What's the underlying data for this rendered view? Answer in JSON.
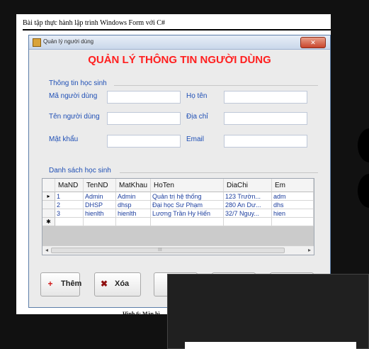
{
  "document": {
    "header": "Bài tập thực hành lập trình Windows Form với C#",
    "caption": "Hình 6: Màn hì"
  },
  "window": {
    "title": "Quản lý người dùng",
    "close_glyph": "✕"
  },
  "form": {
    "main_title": "QUẢN LÝ THÔNG TIN NGƯỜI DÙNG",
    "group_info_label": "Thông tin học sinh",
    "labels": {
      "ma_nguoi_dung": "Mã người dùng",
      "ten_nguoi_dung": "Tên người dùng",
      "mat_khau": "Mật khẩu",
      "ho_ten": "Họ tên",
      "dia_chi": "Địa chỉ",
      "email": "Email"
    },
    "list_label": "Danh sách học sinh"
  },
  "grid": {
    "columns": [
      "MaND",
      "TenND",
      "MatKhau",
      "HoTen",
      "DiaChi",
      "Em"
    ],
    "row_markers": [
      "▸",
      "",
      "",
      "✱"
    ],
    "rows": [
      [
        "1",
        "Admin",
        "Admin",
        "Quản trị hệ thống",
        "123 Trườn...",
        "adm"
      ],
      [
        "2",
        "DHSP",
        "dhsp",
        "Đại học Sư Phạm",
        "280 An Dư...",
        "dhs"
      ],
      [
        "3",
        "hienlth",
        "hienlth",
        "Lương Trần Hy Hiến",
        "32/7 Nguy...",
        "hien"
      ]
    ],
    "scroll_left_glyph": "◂",
    "scroll_right_glyph": "▸",
    "scroll_grip_glyph": "III"
  },
  "buttons": {
    "add": {
      "label": "Thêm",
      "icon": "plus-icon",
      "icon_glyph": "+",
      "icon_color": "#d11a1a"
    },
    "delete": {
      "label": "Xóa",
      "icon": "delete-icon",
      "icon_glyph": "✖",
      "icon_color": "#8f1010"
    }
  },
  "colors": {
    "title": "#ff1f1f",
    "label_blue": "#1f4fb5",
    "cell_blue": "#1c3e9e"
  }
}
